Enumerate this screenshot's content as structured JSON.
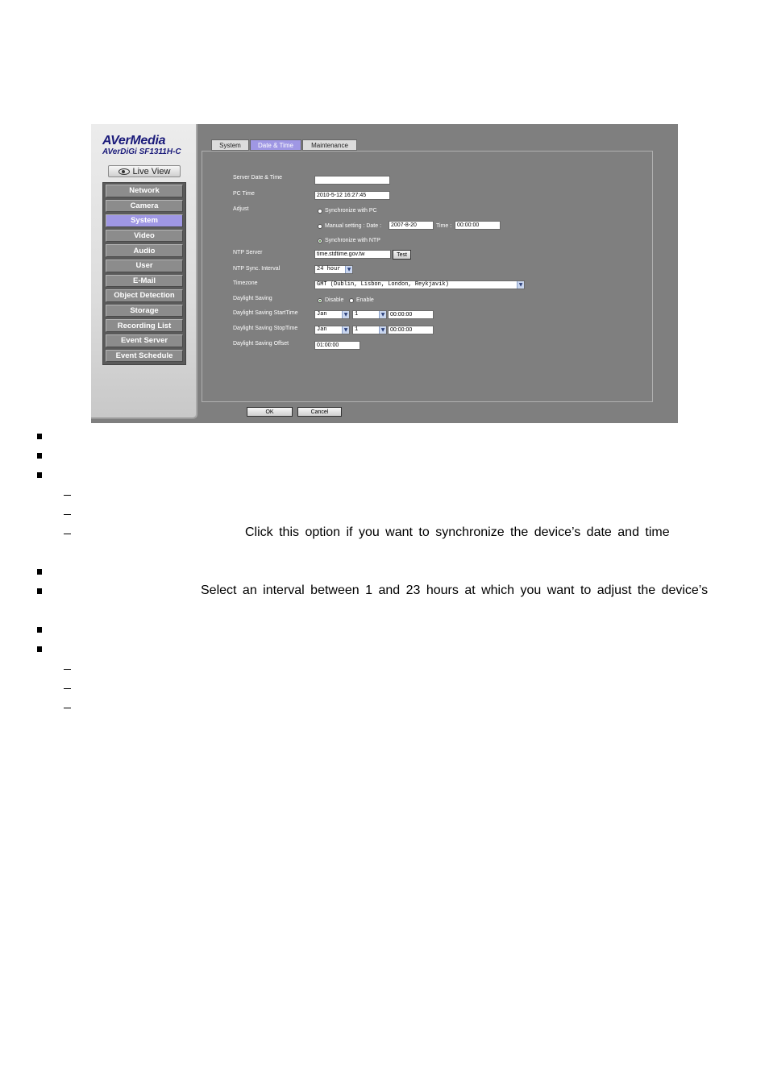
{
  "brand": {
    "logo": "AVerMedia",
    "model": "AVerDiGi SF1311H-C"
  },
  "live_view_label": "Live View",
  "menu": [
    "Network",
    "Camera",
    "System",
    "Video",
    "Audio",
    "User",
    "E-Mail",
    "Object Detection",
    "Storage",
    "Recording List",
    "Event Server",
    "Event Schedule"
  ],
  "menu_active": "System",
  "tabs": [
    "System",
    "Date & Time",
    "Maintenance"
  ],
  "tab_active": "Date & Time",
  "form": {
    "server_date_time_label": "Server Date & Time",
    "server_date_time_value": "",
    "pc_time_label": "PC Time",
    "pc_time_value": "2010-5-12 16:27:45",
    "adjust_label": "Adjust",
    "sync_pc_label": "Synchronize with PC",
    "manual_label": "Manual setting : Date :",
    "manual_date_value": "2007-8-20",
    "manual_time_label": "Time :",
    "manual_time_value": "00:00:00",
    "sync_ntp_label": "Synchronize with NTP",
    "ntp_server_label": "NTP Server",
    "ntp_server_value": "time.stdtime.gov.tw",
    "test_label": "Test",
    "ntp_interval_label": "NTP Sync. Interval",
    "ntp_interval_value": "24 hour",
    "timezone_label": "Timezone",
    "timezone_value": "GMT (Dublin, Lisbon, London, Reykjavik)",
    "daylight_label": "Daylight Saving",
    "disable_label": "Disable",
    "enable_label": "Enable",
    "dst_start_label": "Daylight Saving StartTime",
    "dst_start_month": "Jan",
    "dst_start_day": "1",
    "dst_start_time": "00:00:00",
    "dst_stop_label": "Daylight Saving StopTime",
    "dst_stop_month": "Jan",
    "dst_stop_day": "1",
    "dst_stop_time": "00:00:00",
    "dst_offset_label": "Daylight Saving Offset",
    "dst_offset_value": "01:00:00",
    "ok_label": "OK",
    "cancel_label": "Cancel"
  },
  "doc_text": {
    "line_sync_ntp": "Click this option if you want to synchronize the device’s date and time",
    "line_interval": "Select an interval between 1 and 23 hours at which you want to adjust the device’s"
  }
}
